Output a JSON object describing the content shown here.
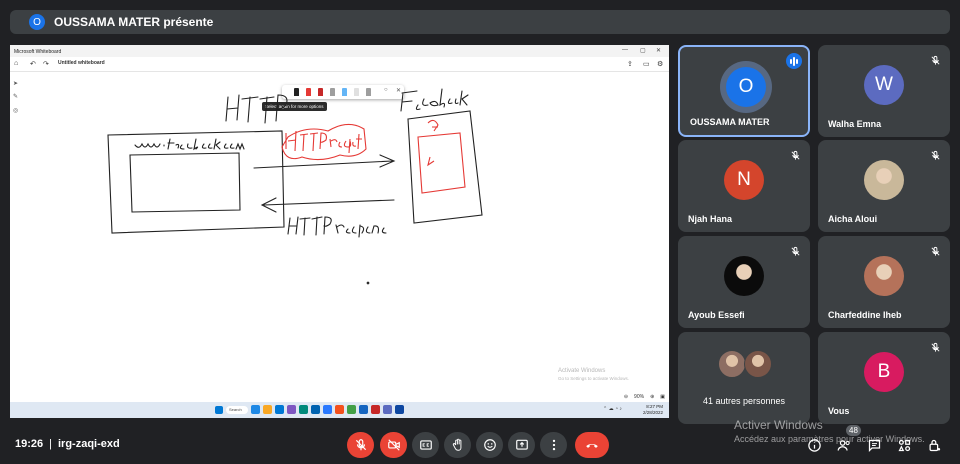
{
  "banner": {
    "avatar_letter": "O",
    "text": "OUSSAMA MATER présente"
  },
  "whiteboard": {
    "window_title": "Microsoft Whiteboard",
    "doc_title": "Untitled whiteboard",
    "tooltip": "Select again for more options",
    "activate_small": [
      "Activate Windows",
      "Go to Settings to activate Windows."
    ],
    "zoom": "90%",
    "taskbar_search": "Search",
    "taskbar_time": "8:27 PM",
    "taskbar_date": "2/28/2022",
    "pen_colors": [
      "#222222",
      "#e53935",
      "#c62828",
      "#9e9e9e",
      "#64b5f6",
      "#e0e0e0",
      "#9e9e9e"
    ],
    "taskbar_icon_colors": [
      "#1e88e5",
      "#f9a825",
      "#0078d4",
      "#7e57c2",
      "#00897b",
      "#0063b1",
      "#2979ff",
      "#f4511e",
      "#43a047",
      "#1565c0",
      "#c62828",
      "#5c6bc0",
      "#0d47a1"
    ]
  },
  "participants": [
    {
      "name": "OUSSAMA MATER",
      "letter": "O",
      "color": "#1a73e8",
      "speaking": true,
      "selected": true
    },
    {
      "name": "Walha Emna",
      "letter": "W",
      "color": "#5c6bc0",
      "speaking": false
    },
    {
      "name": "Njah Hana",
      "letter": "N",
      "color": "#d4452c",
      "speaking": false
    },
    {
      "name": "Aicha Aloui",
      "letter": "",
      "color": "#c9b89a",
      "speaking": false,
      "photo": true
    },
    {
      "name": "Ayoub Essefi",
      "letter": "",
      "color": "#0b0b0b",
      "speaking": false,
      "photo": true
    },
    {
      "name": "Charfeddine Iheb",
      "letter": "",
      "color": "#b5725a",
      "speaking": false,
      "photo": true
    },
    {
      "name": "41 autres personnes",
      "letter": "",
      "color": "#3c4043",
      "speaking": false,
      "group": true
    },
    {
      "name": "Vous",
      "letter": "B",
      "color": "#d81b60",
      "speaking": false
    }
  ],
  "bottom": {
    "time": "19:26",
    "separator": "|",
    "meeting_code": "irg-zaqi-exd",
    "participants_count": "48",
    "watermark_title": "Activer Windows",
    "watermark_sub": "Accédez aux paramètres pour activer Windows."
  },
  "colors": {
    "bg": "#202124",
    "tile": "#3c4043",
    "red": "#ea4335",
    "accent": "#8ab4f8"
  }
}
